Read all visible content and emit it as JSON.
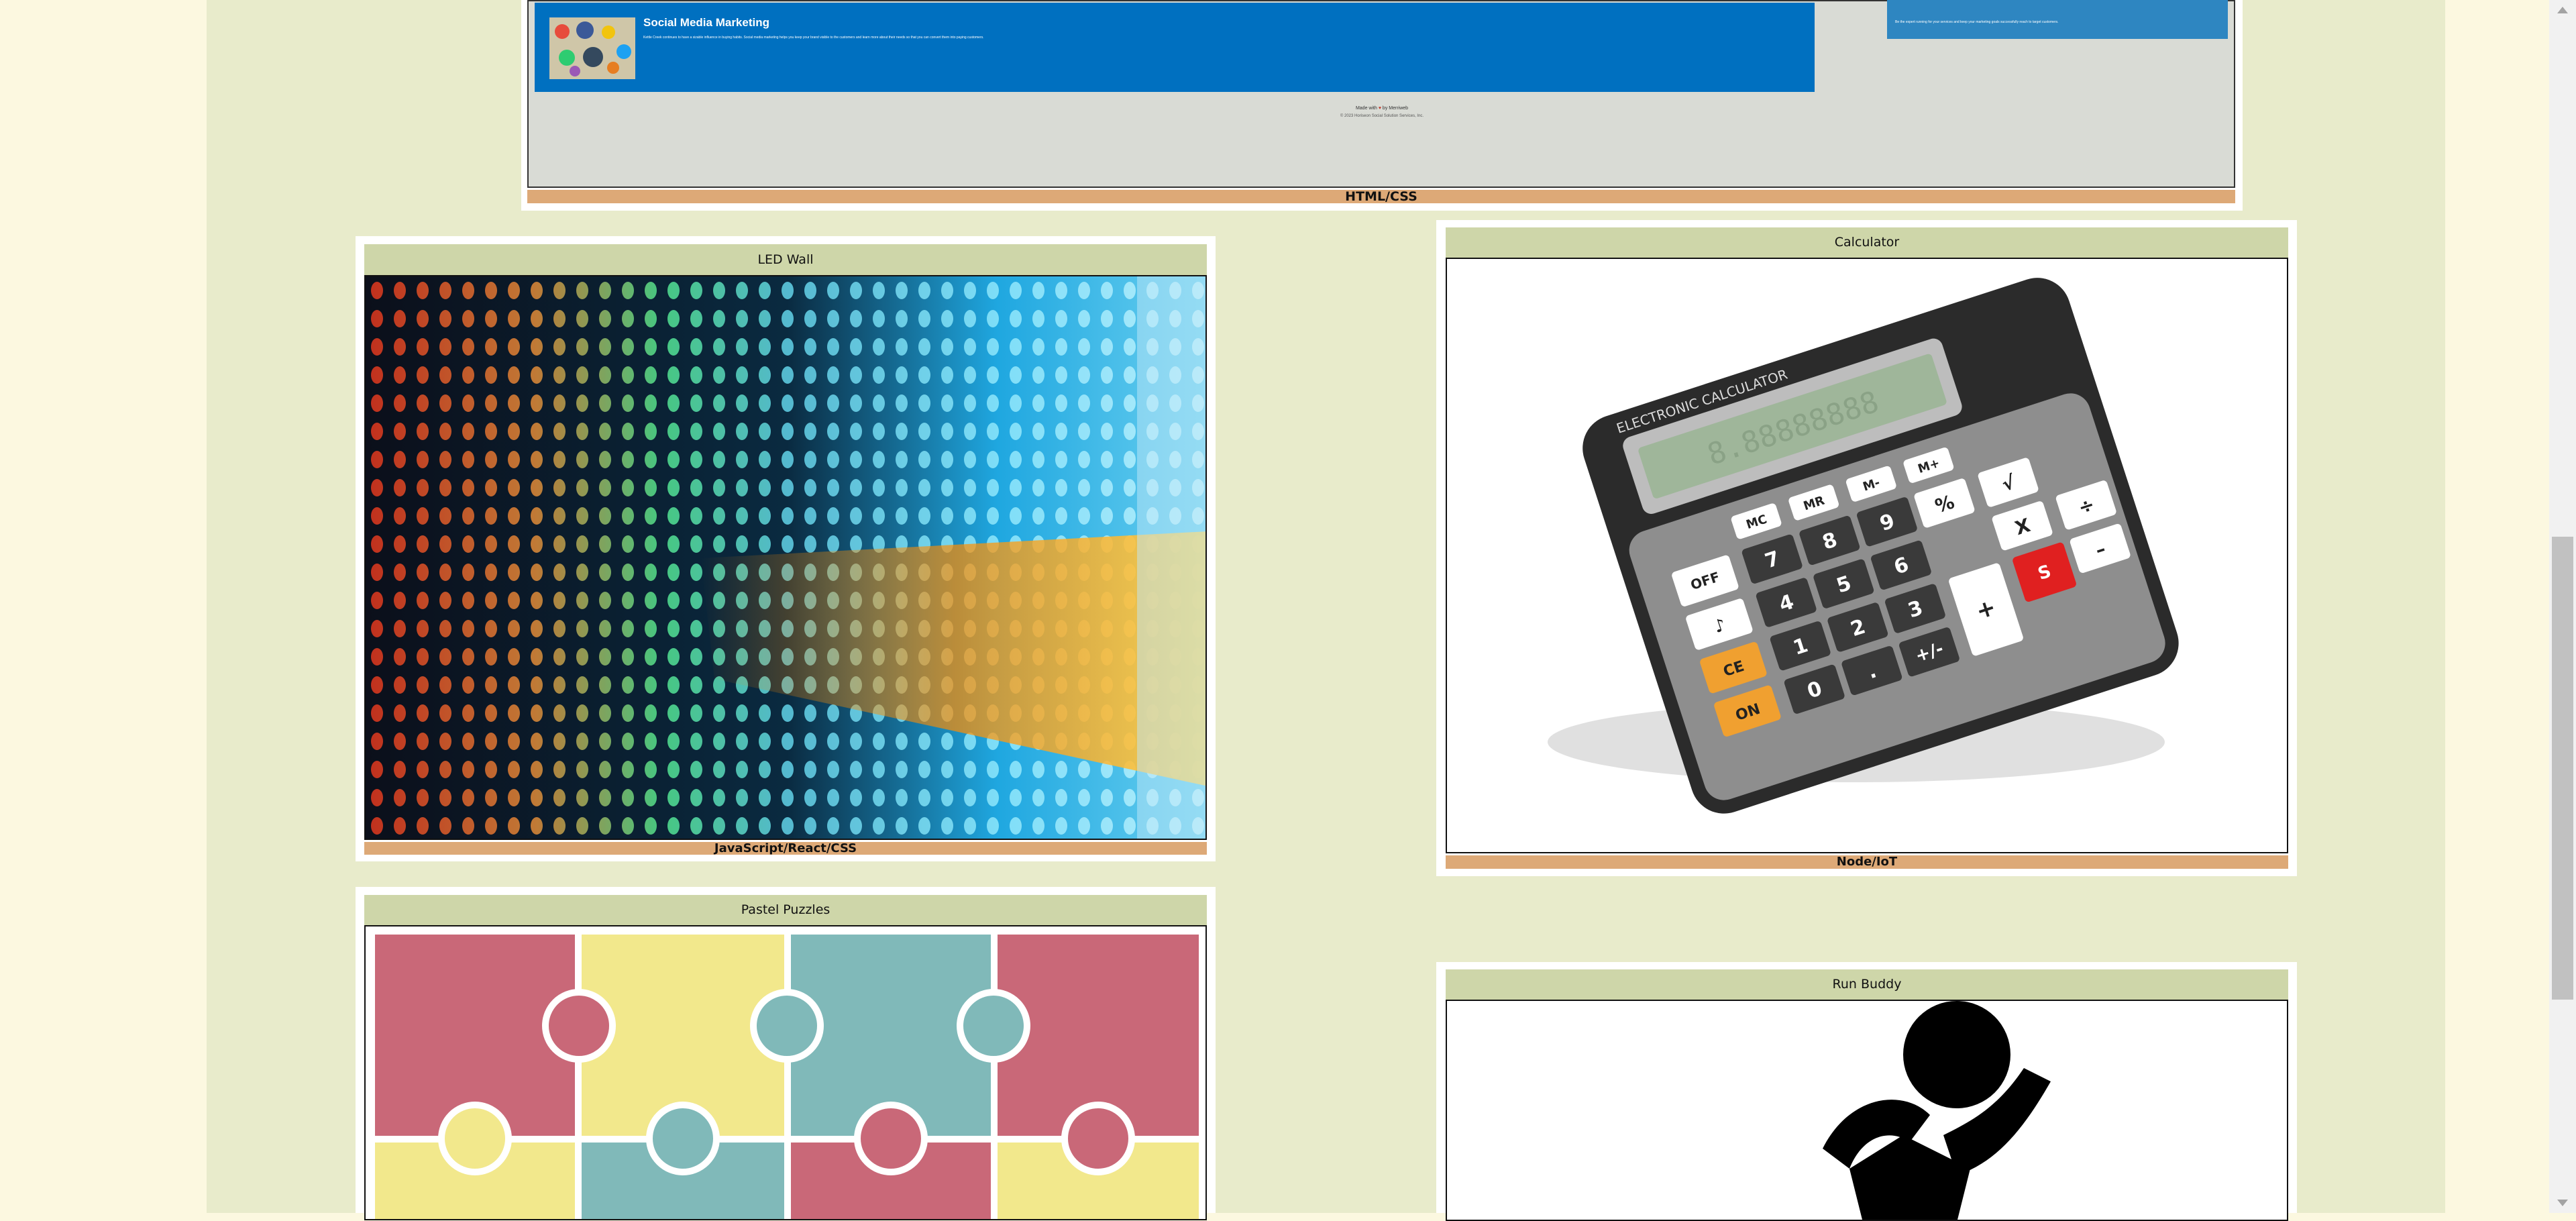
{
  "top_project": {
    "smm_title": "Social Media Marketing",
    "smm_text": "Kettle Creek continues to have a sizable influence in buying habits. Social media marketing helps you keep your brand visible to the customers and learn more about their needs so that you can convert them into paying customers.",
    "right_text": "Be the expert running for your services and keep your marketing goals successfully reach to target customers.",
    "made_with_prefix": "Made with",
    "made_with_heart": "♥",
    "made_with_suffix": "by Merriweb",
    "copyright": "© 2023 Horiseon Social Solution Services, Inc.",
    "footer": "HTML/CSS"
  },
  "cards": {
    "led_wall": {
      "title": "LED Wall",
      "footer": "JavaScript/React/CSS"
    },
    "calculator": {
      "title": "Calculator",
      "footer": "Node/IoT",
      "brand": "ELECTRONIC CALCULATOR",
      "display": "8.88888888",
      "keys": [
        "MC",
        "MR",
        "M-",
        "M+",
        "%",
        "√",
        "X",
        "÷",
        "–",
        "7",
        "8",
        "9",
        "6",
        "5",
        "4",
        "3",
        "2",
        "1",
        "0",
        ".",
        "+/-",
        "+",
        "OFF",
        "♪",
        "CE",
        "ON",
        "S"
      ]
    },
    "pastel_puzzles": {
      "title": "Pastel Puzzles"
    },
    "run_buddy": {
      "title": "Run Buddy"
    }
  },
  "colors": {
    "page_bg": "#fcf8e0",
    "main_bg": "#e8ebcb",
    "header_bg": "#ced6a9",
    "footer_bg": "#dda977",
    "smm_blue": "#0070c0"
  },
  "icons": {
    "scroll_up": "scroll-up-icon",
    "scroll_down": "scroll-down-icon",
    "heart": "heart-icon"
  }
}
